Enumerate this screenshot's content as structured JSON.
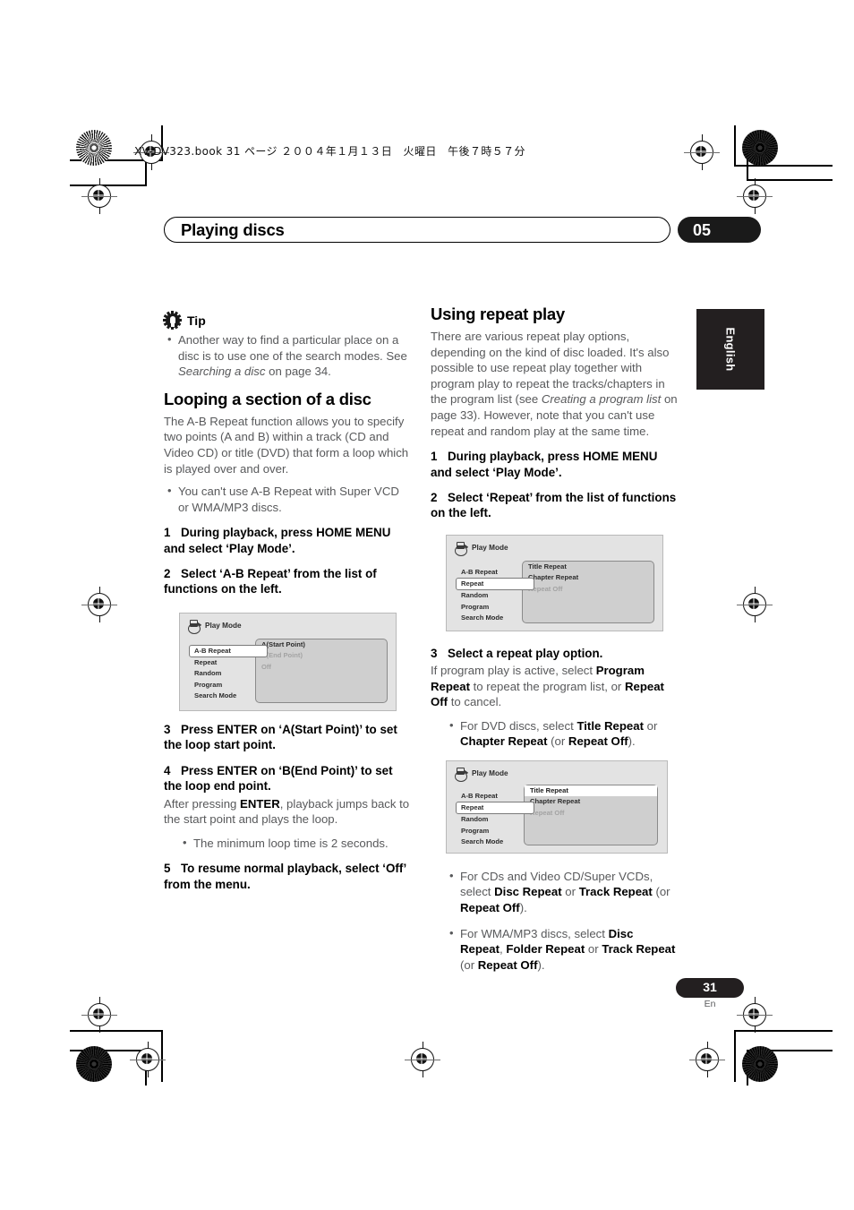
{
  "print_header": {
    "filename": "XV-DV323.book",
    "page_ref": "31 ページ",
    "date": "２００４年１月１３日",
    "weekday": "火曜日",
    "time": "午後７時５７分",
    "full_line": "XV-DV323.book  31 ページ  ２００４年１月１３日　火曜日　午後７時５７分"
  },
  "chapter": {
    "title": "Playing discs",
    "number": "05"
  },
  "side_tab": {
    "language": "English"
  },
  "footer": {
    "page_number": "31",
    "language_code": "En"
  },
  "left_column": {
    "tip": {
      "icon": "gear-icon",
      "label": "Tip",
      "bullets": [
        "Another way to find a particular place on a disc is to use one of the search modes. See Searching a disc on page 34."
      ]
    },
    "section": {
      "heading": "Looping a section of a disc",
      "intro": "The A-B Repeat function allows you to specify two points (A and B) within a track (CD and Video CD) or title (DVD) that form a loop which is played over and over.",
      "note_bullet": "You can't use A-B Repeat with Super VCD or WMA/MP3 discs.",
      "steps": [
        {
          "num": "1",
          "text": "During playback, press HOME MENU and select ‘Play Mode’."
        },
        {
          "num": "2",
          "text": "Select ‘A-B Repeat’ from the list of functions on the left."
        },
        {
          "num": "3",
          "text": "Press ENTER on ‘A(Start Point)’ to set the loop start point."
        },
        {
          "num": "4",
          "text": "Press ENTER on ‘B(End Point)’ to set the loop end point."
        },
        {
          "num": "5",
          "text": "To resume normal playback, select ‘Off’ from the menu."
        }
      ],
      "step4_after": "After pressing ENTER, playback jumps back to the start point and plays the loop.",
      "step4_bullet": "The minimum loop time is 2 seconds."
    }
  },
  "right_column": {
    "section": {
      "heading": "Using repeat play",
      "intro": "There are various repeat play options, depending on the kind of disc loaded. It's also possible to use repeat play together with program play to repeat the tracks/chapters in the program list (see Creating a program list on page 33). However, note that you can't use repeat and random play at the same time.",
      "steps": [
        {
          "num": "1",
          "text": "During playback, press HOME MENU and select ‘Play Mode’."
        },
        {
          "num": "2",
          "text": "Select ‘Repeat’ from the list of functions on the left."
        },
        {
          "num": "3",
          "text": "Select a repeat play option."
        }
      ],
      "step3_after": "If program play is active, select Program Repeat to repeat the program list, or Repeat Off to cancel.",
      "bullets": [
        "For DVD discs, select Title Repeat or Chapter Repeat (or Repeat Off).",
        "For CDs and Video CD/Super VCDs, select Disc Repeat or Track Repeat (or Repeat Off).",
        "For WMA/MP3 discs, select Disc Repeat, Folder Repeat or Track Repeat (or Repeat Off)."
      ]
    }
  },
  "osd_menus": [
    {
      "id": "ab-repeat-menu",
      "title": "Play Mode",
      "functions": [
        "A-B Repeat",
        "Repeat",
        "Random",
        "Program",
        "Search Mode"
      ],
      "selected_function": "A-B Repeat",
      "options": [
        {
          "label": "A(Start Point)",
          "state": "normal"
        },
        {
          "label": "B(End Point)",
          "state": "dimmed"
        },
        {
          "label": "Off",
          "state": "dimmed"
        }
      ]
    },
    {
      "id": "repeat-menu",
      "title": "Play Mode",
      "functions": [
        "A-B Repeat",
        "Repeat",
        "Random",
        "Program",
        "Search Mode"
      ],
      "selected_function": "Repeat",
      "options": [
        {
          "label": "Title Repeat",
          "state": "normal"
        },
        {
          "label": "Chapter Repeat",
          "state": "normal"
        },
        {
          "label": "Repeat Off",
          "state": "dimmed"
        }
      ]
    },
    {
      "id": "title-repeat-menu",
      "title": "Play Mode",
      "functions": [
        "A-B Repeat",
        "Repeat",
        "Random",
        "Program",
        "Search Mode"
      ],
      "selected_function": "Repeat",
      "options": [
        {
          "label": "Title Repeat",
          "state": "highlighted"
        },
        {
          "label": "Chapter Repeat",
          "state": "normal"
        },
        {
          "label": "Repeat Off",
          "state": "dimmed"
        }
      ]
    }
  ],
  "colors": {
    "ink": "#231f20",
    "body_text": "#58595b",
    "osd_background": "#e3e3e3",
    "osd_panel": "#cfcfcf",
    "accent_black": "#1a1a1a"
  }
}
